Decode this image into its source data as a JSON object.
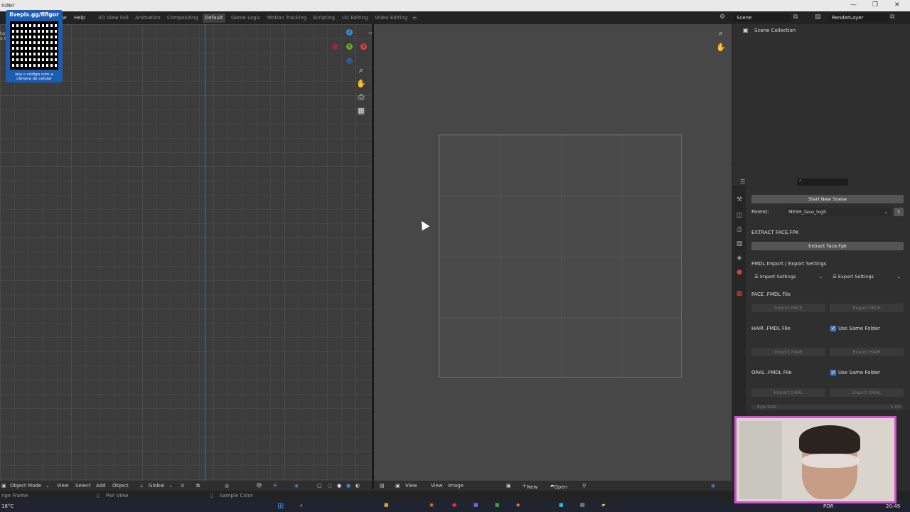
{
  "titlebar": {
    "title": "nder"
  },
  "topbar": {
    "menus": [
      "w",
      "Help"
    ],
    "workspaces": [
      "3D View Full",
      "Animation",
      "Compositing",
      "Default",
      "Game Logic",
      "Motion Tracking",
      "Scripting",
      "UV Editing",
      "Video Editing"
    ],
    "active_workspace": "Default",
    "add_tab": "+",
    "scene_label": "Scene",
    "view_layer_label": "RenderLayer"
  },
  "overlay": {
    "qr_top_text": "livepix.gg/fifigor",
    "qr_bottom_text": "leia o código com a câmera do celular",
    "left_edge_text": [
      "ho",
      "e C"
    ]
  },
  "viewport_left": {
    "gizmo_axes": {
      "z": "Z",
      "y": "Y",
      "x": "X"
    }
  },
  "bottom_left_header": {
    "mode": "Object Mode",
    "menus": [
      "View",
      "Select",
      "Add",
      "Object"
    ],
    "transform_orientation": "Global"
  },
  "bottom_right_header": {
    "menus": [
      "View",
      "View",
      "Image"
    ],
    "new_label": "New",
    "open_label": "Open"
  },
  "statusbar": {
    "left": "nge Frame",
    "pan": "Pan View",
    "sample": "Sample Color"
  },
  "outliner": {
    "title": "Scene Collection"
  },
  "properties": {
    "start_new_scene": "Start New Scene",
    "parent_label": "Parent:",
    "parent_value": "MESH_face_high",
    "extract_title": "EXTRACT FACE.FPK",
    "extract_button": "Extract Face.Fpk",
    "fmdl_title": "FMDL Import / Export Settings",
    "import_settings": "Import Settings",
    "export_settings": "Export Settings",
    "face_title": "FACE .FMDL File",
    "import_face": "Import FACE",
    "export_face": "Export FACE",
    "hair_title": "HAIR .FMDL File",
    "use_same_folder": "Use Same Folder",
    "import_hair": "Import HAIR",
    "export_hair": "Export HAIR",
    "oral_title": "ORAL .FMDL File",
    "import_oral": "Import ORAL",
    "export_oral": "Export ORAL",
    "eye_size_label": "Eye Size",
    "eye_size_value": "1.00"
  },
  "taskbar": {
    "temperature": "18°C",
    "language": "POR",
    "time": "20:49"
  },
  "colors": {
    "accent": "#4a7fc7",
    "axis_x": "#e0404a",
    "axis_y": "#6aa82c",
    "axis_z": "#3f8ce0",
    "webcam_border": "#d24fd0"
  }
}
